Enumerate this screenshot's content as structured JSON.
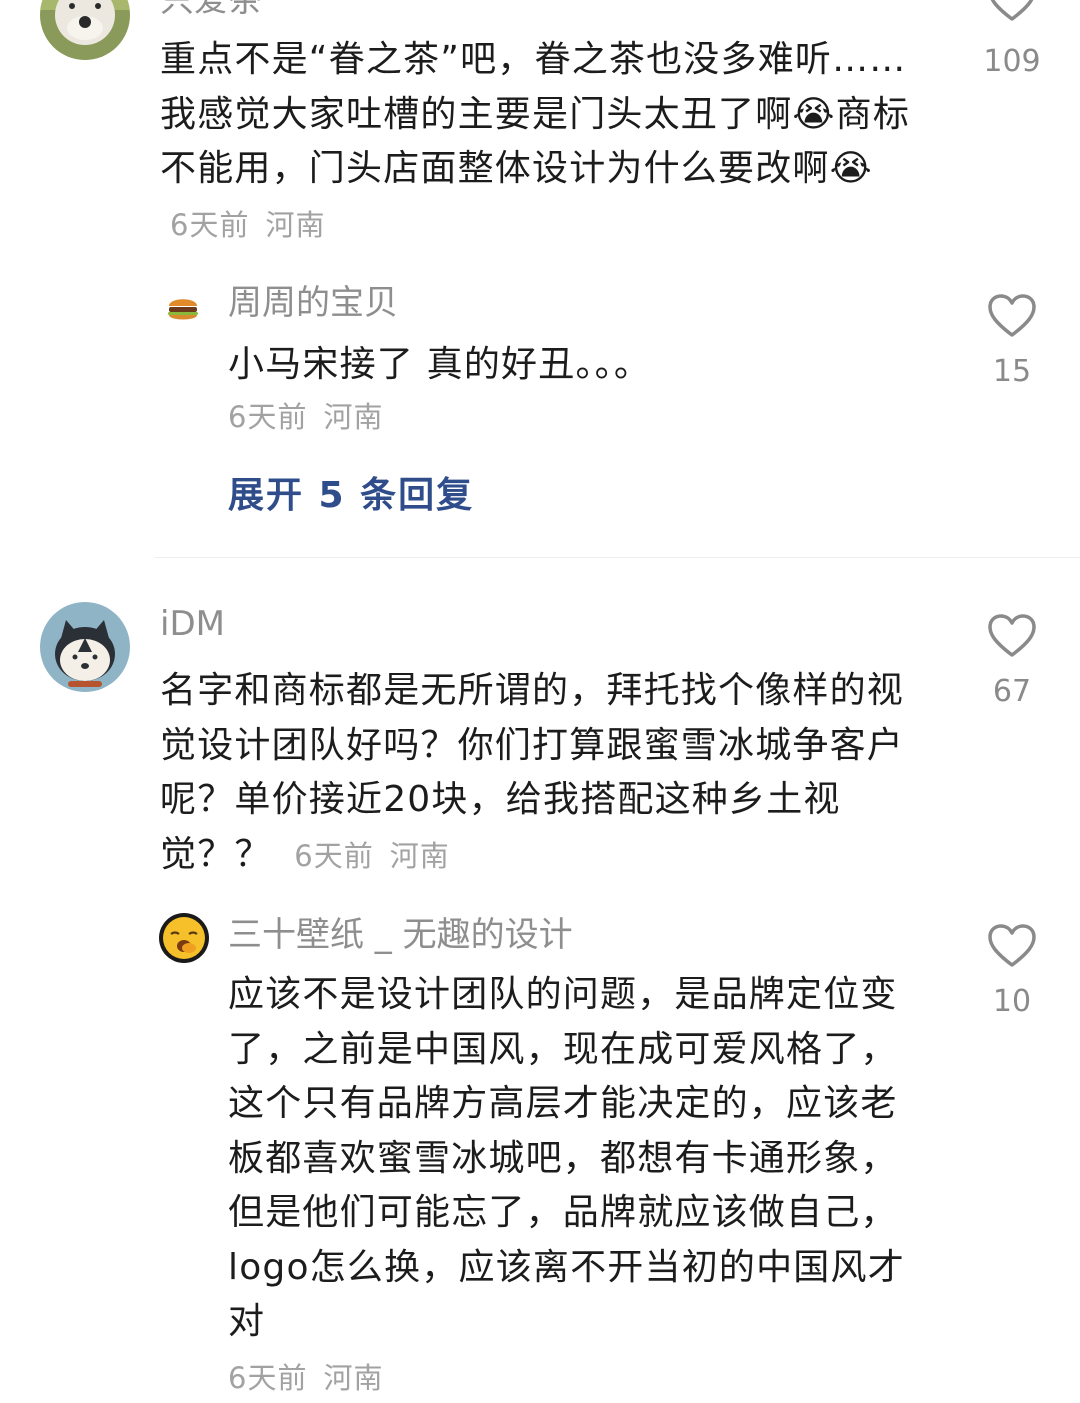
{
  "comments": [
    {
      "id": "c1",
      "username": "只爱茶",
      "text": "重点不是“眷之茶”吧，眷之茶也没多难听……我感觉大家吐槽的主要是门头太丑了啊😭商标不能用，门头店面整体设计为什么要改啊😭",
      "time": "6天前",
      "location": "河南",
      "likes": "109",
      "reply": {
        "username": "周周的宝贝",
        "text": "小马宋接了 真的好丑。。。",
        "time": "6天前",
        "location": "河南",
        "likes": "15"
      },
      "expand_label": "展开 5 条回复"
    },
    {
      "id": "c2",
      "username": "iDM",
      "text": "名字和商标都是无所谓的，拜托找个像样的视觉设计团队好吗？你们打算跟蜜雪冰城争客户呢？单价接近20块，给我搭配这种乡土视觉？？",
      "time": "6天前",
      "location": "河南",
      "likes": "67",
      "reply": {
        "username": "三十壁纸 _ 无趣的设计",
        "text": "应该不是设计团队的问题，是品牌定位变了，之前是中国风，现在成可爱风格了，这个只有品牌方高层才能决定的，应该老板都喜欢蜜雪冰城吧，都想有卡通形象，但是他们可能忘了，品牌就应该做自己，logo怎么换，应该离不开当初的中国风才对",
        "time": "6天前",
        "location": "河南",
        "likes": "10"
      }
    }
  ],
  "icons": {
    "like": "heart-outline-icon",
    "emoji": "crying-peach-emoji"
  },
  "colors": {
    "link": "#2f4d8a",
    "meta": "#a2a2a2",
    "username": "#8e8e8e",
    "divider": "#ededed"
  }
}
